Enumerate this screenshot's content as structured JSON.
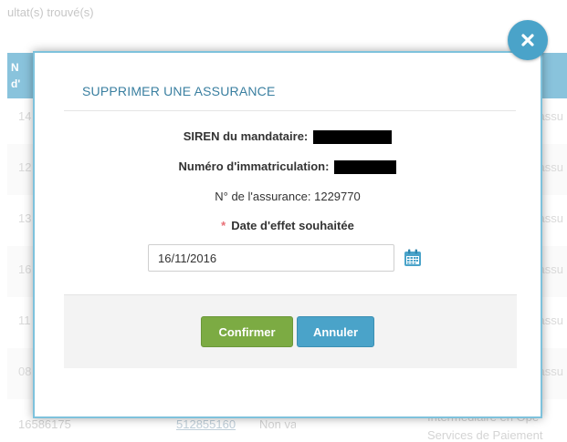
{
  "background": {
    "result_count_text": "ultat(s) trouvé(s)",
    "table_header_text": "N\nd'",
    "rows": [
      {
        "left": "14",
        "right": "assu"
      },
      {
        "left": "12",
        "right": "assu"
      },
      {
        "left": "13",
        "right": "assu"
      },
      {
        "left": "16",
        "right": "assu"
      },
      {
        "left": "11",
        "right": "assu"
      },
      {
        "left": "08",
        "right": "assu"
      }
    ],
    "last_row": {
      "id": "16586175",
      "code": "512855160",
      "status": "Non valide",
      "type": "Intermédiaire en Opé",
      "sub": "Services de Paiement"
    }
  },
  "modal": {
    "title": "SUPPRIMER UNE ASSURANCE",
    "siren_label": "SIREN du mandataire:",
    "immat_label": "Numéro d'immatriculation:",
    "assurance_label": "N° de l'assurance:",
    "assurance_value": "1229770",
    "date_required_mark": "*",
    "date_label": "Date d'effet souhaitée",
    "date_value": "16/11/2016",
    "confirm_label": "Confirmer",
    "cancel_label": "Annuler"
  },
  "icons": {
    "close": "close-icon",
    "calendar": "calendar-icon"
  },
  "colors": {
    "accent_blue": "#4aa3c9",
    "confirm_green": "#7cab43",
    "required_red": "#e86f76"
  }
}
